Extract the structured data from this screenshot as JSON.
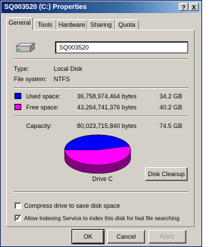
{
  "window": {
    "title": "SQ003520 (C:) Properties",
    "help_label": "?",
    "close_label": "X"
  },
  "tabs": [
    {
      "label": "General",
      "active": true
    },
    {
      "label": "Tools",
      "active": false
    },
    {
      "label": "Hardware",
      "active": false
    },
    {
      "label": "Sharing",
      "active": false
    },
    {
      "label": "Quota",
      "active": false
    }
  ],
  "general": {
    "drive_icon": "hard-drive-icon",
    "name_value": "SQ003520",
    "type_label": "Type:",
    "type_value": "Local Disk",
    "fs_label": "File system:",
    "fs_value": "NTFS",
    "used_label": "Used space:",
    "used_bytes": "36,758,974,464 bytes",
    "used_gb": "34.2 GB",
    "used_color": "#0000ff",
    "free_label": "Free space:",
    "free_bytes": "43,264,741,376 bytes",
    "free_gb": "40.2 GB",
    "free_color": "#ff00ff",
    "capacity_label": "Capacity:",
    "capacity_bytes": "80,023,715,840 bytes",
    "capacity_gb": "74.5 GB",
    "used_fraction": 0.459,
    "drive_label": "Drive C",
    "cleanup_label": "Disk Cleanup",
    "compress_label": "Compress drive to save disk space",
    "compress_checked": false,
    "index_label": "Allow Indexing Service to index this disk for fast file searching",
    "index_checked": true,
    "check_mark": "✓"
  },
  "buttons": {
    "ok": "OK",
    "cancel": "Cancel",
    "apply": "Apply"
  }
}
